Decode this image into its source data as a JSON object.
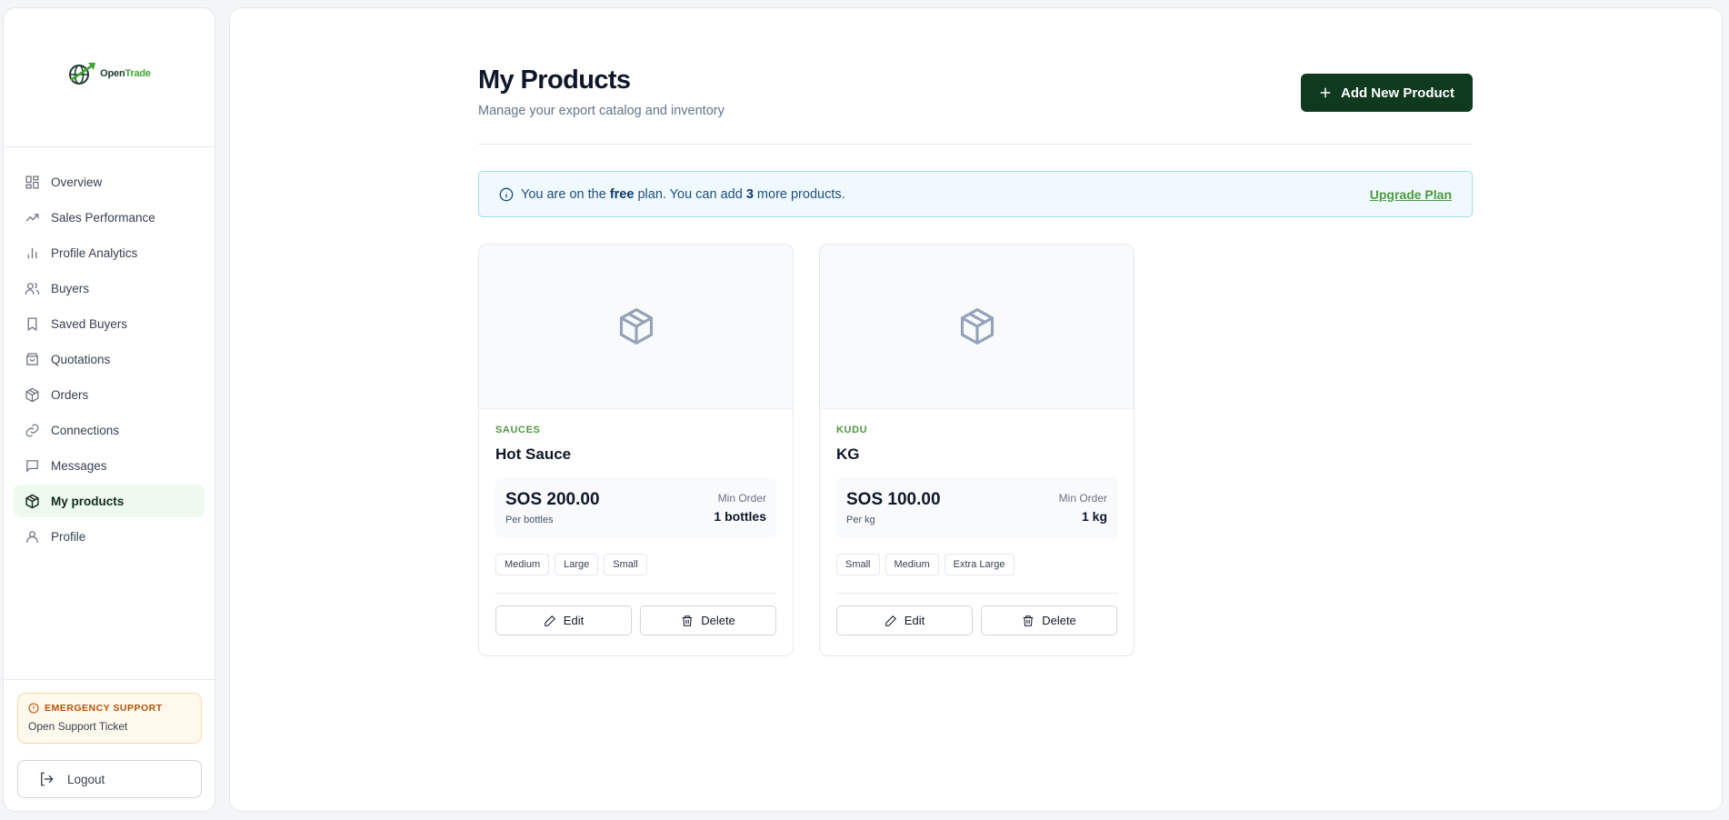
{
  "brand": {
    "name_part1": "Open",
    "name_part2": "Trade"
  },
  "sidebar": {
    "items": [
      {
        "label": "Overview",
        "icon": "grid-icon"
      },
      {
        "label": "Sales Performance",
        "icon": "trending-up-icon"
      },
      {
        "label": "Profile Analytics",
        "icon": "bar-chart-icon"
      },
      {
        "label": "Buyers",
        "icon": "users-icon"
      },
      {
        "label": "Saved Buyers",
        "icon": "bookmark-icon"
      },
      {
        "label": "Quotations",
        "icon": "shopping-bag-icon"
      },
      {
        "label": "Orders",
        "icon": "package-icon"
      },
      {
        "label": "Connections",
        "icon": "link-icon"
      },
      {
        "label": "Messages",
        "icon": "message-square-icon"
      },
      {
        "label": "My products",
        "icon": "package-icon",
        "active": true
      },
      {
        "label": "Profile",
        "icon": "user-icon"
      }
    ],
    "emergency_title": "EMERGENCY SUPPORT",
    "emergency_link": "Open Support Ticket",
    "logout_label": "Logout"
  },
  "header": {
    "title": "My Products",
    "subtitle": "Manage your export catalog and inventory",
    "add_button": "Add New Product"
  },
  "plan": {
    "prefix": "You are on the",
    "plan_name": "free",
    "middle": "plan. You can add",
    "count": "3",
    "suffix": "more products.",
    "upgrade_label": "Upgrade Plan"
  },
  "products": [
    {
      "category": "SAUCES",
      "name": "Hot Sauce",
      "price": "SOS 200.00",
      "per_unit": "Per bottles",
      "min_order_label": "Min Order",
      "min_order_value": "1 bottles",
      "tags": [
        "Medium",
        "Large",
        "Small"
      ],
      "edit_label": "Edit",
      "delete_label": "Delete"
    },
    {
      "category": "KUDU",
      "name": "KG",
      "price": "SOS 100.00",
      "per_unit": "Per kg",
      "min_order_label": "Min Order",
      "min_order_value": "1 kg",
      "tags": [
        "Small",
        "Medium",
        "Extra Large"
      ],
      "edit_label": "Edit",
      "delete_label": "Delete"
    }
  ],
  "colors": {
    "accent_dark": "#0f3a20",
    "accent_green": "#4c9a3f",
    "active_bg": "#eefaf0",
    "banner_bg": "#f0f9ff",
    "emergency": "#b45309"
  }
}
